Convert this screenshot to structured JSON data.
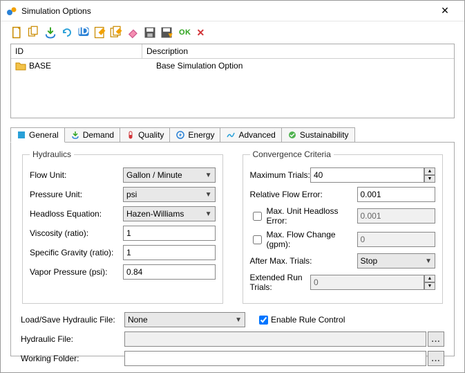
{
  "window": {
    "title": "Simulation Options"
  },
  "list": {
    "columns": {
      "id": "ID",
      "desc": "Description"
    },
    "rows": [
      {
        "id": "BASE",
        "desc": "Base Simulation Option"
      }
    ]
  },
  "tabs": {
    "general": "General",
    "demand": "Demand",
    "quality": "Quality",
    "energy": "Energy",
    "advanced": "Advanced",
    "sustainability": "Sustainability"
  },
  "hydraulics": {
    "legend": "Hydraulics",
    "flow_unit_label": "Flow Unit:",
    "flow_unit_value": "Gallon / Minute",
    "pressure_unit_label": "Pressure Unit:",
    "pressure_unit_value": "psi",
    "headloss_label": "Headloss Equation:",
    "headloss_value": "Hazen-Williams",
    "viscosity_label": "Viscosity (ratio):",
    "viscosity_value": "1",
    "sg_label": "Specific Gravity (ratio):",
    "sg_value": "1",
    "vapor_label": "Vapor Pressure (psi):",
    "vapor_value": "0.84"
  },
  "convergence": {
    "legend": "Convergence Criteria",
    "max_trials_label": "Maximum Trials:",
    "max_trials_value": "40",
    "rel_flow_label": "Relative Flow Error:",
    "rel_flow_value": "0.001",
    "max_unit_hl_label": "Max. Unit Headloss Error:",
    "max_unit_hl_value": "0.001",
    "max_flow_chg_label": "Max. Flow Change (gpm):",
    "max_flow_chg_value": "0",
    "after_max_label": "After Max. Trials:",
    "after_max_value": "Stop",
    "ext_run_label": "Extended Run Trials:",
    "ext_run_value": "0"
  },
  "bottom": {
    "load_save_label": "Load/Save Hydraulic File:",
    "load_save_value": "None",
    "enable_rule_label": "Enable Rule Control",
    "hydraulic_file_label": "Hydraulic File:",
    "hydraulic_file_value": "",
    "working_folder_label": "Working Folder:",
    "working_folder_value": "",
    "browse": "..."
  },
  "toolbar": {
    "ok": "OK"
  }
}
